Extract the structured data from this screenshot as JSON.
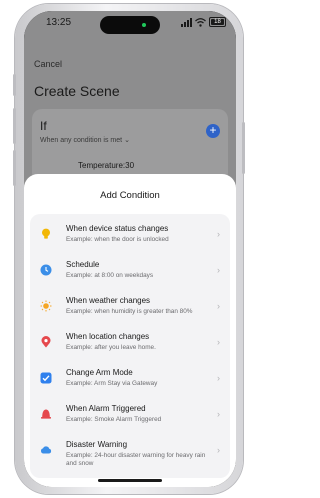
{
  "status_bar": {
    "time": "13:25",
    "battery": "18"
  },
  "header": {
    "cancel_label": "Cancel",
    "title": "Create Scene"
  },
  "if_card": {
    "label": "If",
    "subtitle": "When any condition is met",
    "add_label": "+",
    "condition_preview": "Temperature:30"
  },
  "sheet": {
    "title": "Add Condition",
    "items": [
      {
        "icon": "lightbulb-icon",
        "color": "#f2b705",
        "title": "When device status changes",
        "desc": "Example: when the door is unlocked"
      },
      {
        "icon": "clock-icon",
        "color": "#3b8ee8",
        "title": "Schedule",
        "desc": "Example: at 8:00 on weekdays"
      },
      {
        "icon": "sun-icon",
        "color": "#f5a623",
        "title": "When weather changes",
        "desc": "Example: when humidity is greater than 80%"
      },
      {
        "icon": "location-pin-icon",
        "color": "#e5484d",
        "title": "When location changes",
        "desc": "Example: after you leave home."
      },
      {
        "icon": "checkbox-icon",
        "color": "#2f80ed",
        "title": "Change Arm Mode",
        "desc": "Example: Arm Stay via Gateway"
      },
      {
        "icon": "alarm-bell-icon",
        "color": "#e5484d",
        "title": "When Alarm Triggered",
        "desc": "Example: Smoke Alarm Triggered"
      },
      {
        "icon": "cloud-icon",
        "color": "#3b8ee8",
        "title": "Disaster Warning",
        "desc": "Example: 24-hour disaster warning for heavy rain and snow"
      }
    ]
  }
}
